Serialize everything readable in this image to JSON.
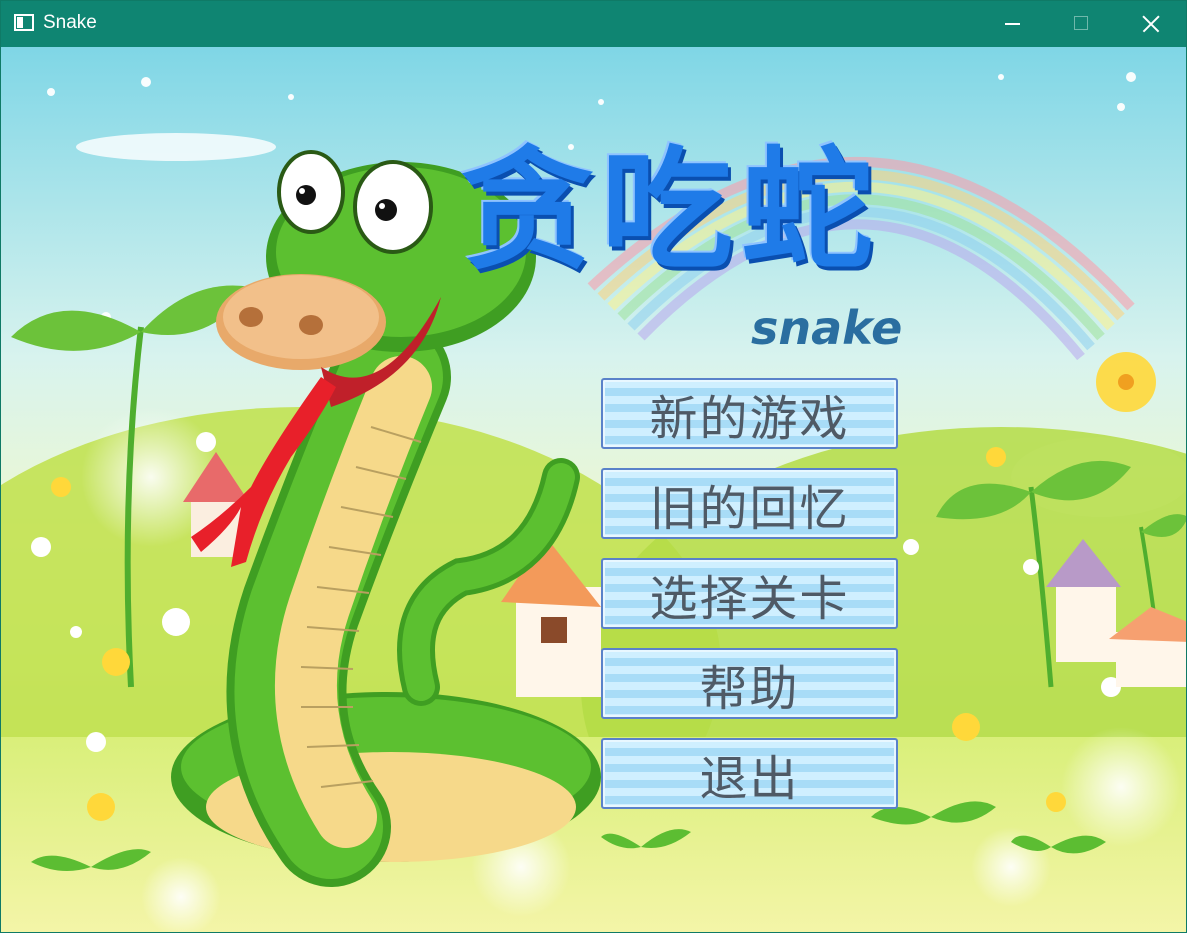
{
  "window": {
    "title": "Snake"
  },
  "logo": {
    "chinese_title": "贪吃蛇",
    "english_title": "snake"
  },
  "menu": {
    "items": [
      {
        "label": "新的游戏"
      },
      {
        "label": "旧的回忆"
      },
      {
        "label": "选择关卡"
      },
      {
        "label": "帮助"
      },
      {
        "label": "退出"
      }
    ]
  },
  "colors": {
    "titlebar": "#0f8572",
    "logo_blue": "#1f7be8",
    "menu_border": "#5a82c9",
    "snake_green": "#4cb82a"
  }
}
